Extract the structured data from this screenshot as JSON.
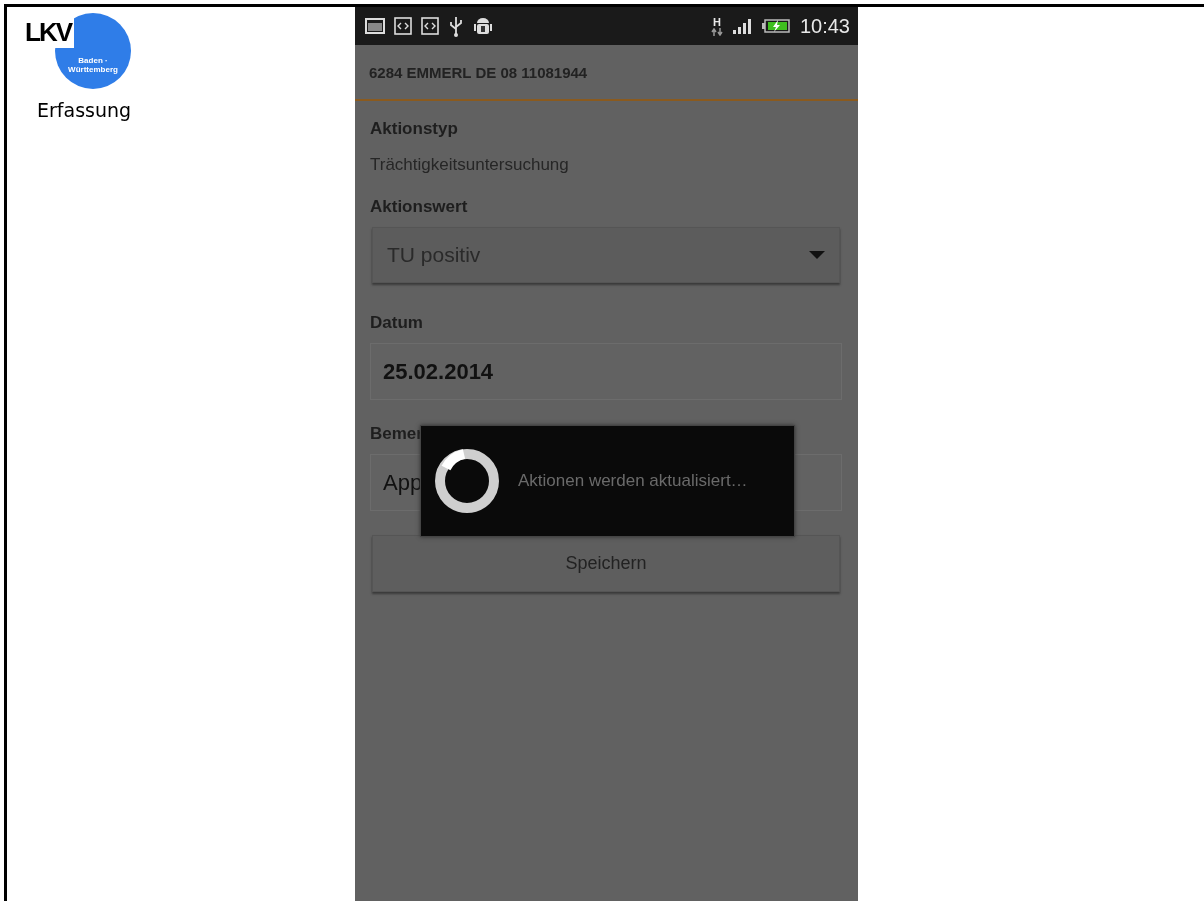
{
  "slide": {
    "logo": {
      "text": "LKV",
      "subtext": "Baden · Württemberg"
    },
    "title": "Erfassung"
  },
  "phone": {
    "status_bar": {
      "network_type": "H",
      "time": "10:43",
      "battery_charging": true
    },
    "app_bar": {
      "title": "6284 EMMERL DE 08 11081944"
    },
    "fields": [
      {
        "kind": "static",
        "label": "Aktionstyp",
        "value": "Trächtigkeitsuntersuchung",
        "bold": false
      },
      {
        "kind": "dropdown",
        "label": "Aktionswert",
        "value": "TU positiv",
        "bold": false
      },
      {
        "kind": "input",
        "label": "Datum",
        "value": "25.02.2014",
        "bold": true
      },
      {
        "kind": "input",
        "label": "Bemer",
        "value": "App",
        "bold": false
      }
    ],
    "save_button": "Speichern",
    "progress_dialog": {
      "message": "Aktionen werden aktualisiert…"
    }
  }
}
